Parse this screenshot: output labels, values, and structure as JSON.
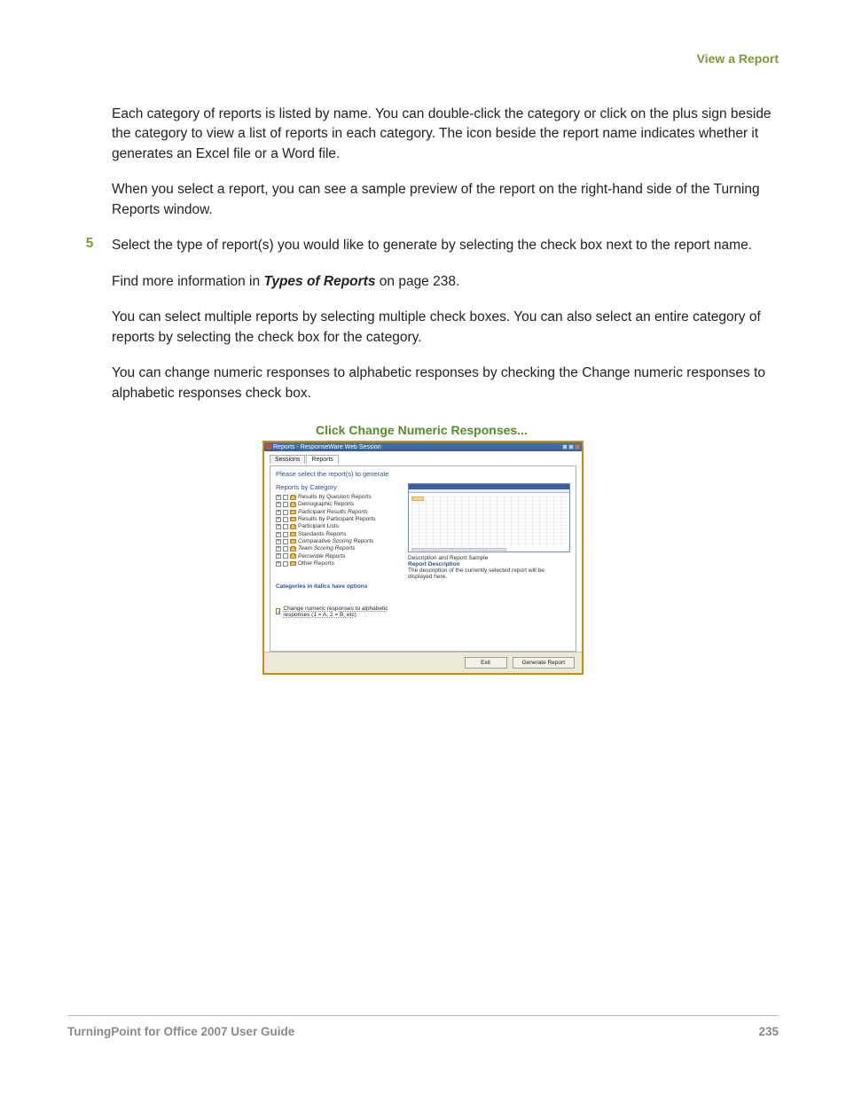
{
  "header": {
    "link": "View a Report"
  },
  "paragraphs": {
    "p1": "Each category of reports is listed by name. You can double-click the category or click on the plus sign beside the category to view a list of reports in each category. The icon beside the report name indicates whether it generates an Excel file or a Word file.",
    "p2": "When you select a report, you can see a sample preview of the report on the right-hand side of the Turning Reports window.",
    "step5": "Select the type of report(s) you would like to generate by selecting the check box next to the report name.",
    "p3a": "Find more information in ",
    "p3b": "Types of Reports",
    "p3c": " on page 238.",
    "p4": "You can select multiple reports by selecting multiple check boxes. You can also select an entire category of reports by selecting the check box for the category.",
    "p5": "You can change numeric responses to alphabetic responses by checking the Change numeric responses to alphabetic responses check box."
  },
  "step_number": "5",
  "caption": "Click Change Numeric Responses...",
  "screenshot": {
    "title": "Reports - ResponseWare Web Session",
    "tabs": {
      "sessions": "Sessions",
      "reports": "Reports"
    },
    "instruction": "Please select the report(s) to generate",
    "section": "Reports by Category",
    "tree": [
      {
        "label": "Results by Question Reports",
        "italic": false
      },
      {
        "label": "Demographic Reports",
        "italic": false
      },
      {
        "label": "Participant Results Reports",
        "italic": true
      },
      {
        "label": "Results by Participant Reports",
        "italic": false
      },
      {
        "label": "Participant Lists",
        "italic": false
      },
      {
        "label": "Standards Reports",
        "italic": false
      },
      {
        "label": "Comparative Scoring Reports",
        "italic": true
      },
      {
        "label": "Team Scoring Reports",
        "italic": true
      },
      {
        "label": "Percentile Reports",
        "italic": true
      },
      {
        "label": "Other Reports",
        "italic": false
      }
    ],
    "options_note": "Categories in italics have options",
    "checkbox_label": "Change numeric responses to alphabetic responses (1 = A, 2 = B, etc)",
    "desc": {
      "line1": "Description and Report Sample",
      "line2": "Report Description",
      "line3": "The description of the currently selected report will be displayed here."
    },
    "buttons": {
      "exit": "Exit",
      "generate": "Generate Report"
    }
  },
  "footer": {
    "left": "TurningPoint for Office 2007 User Guide",
    "right": "235"
  }
}
